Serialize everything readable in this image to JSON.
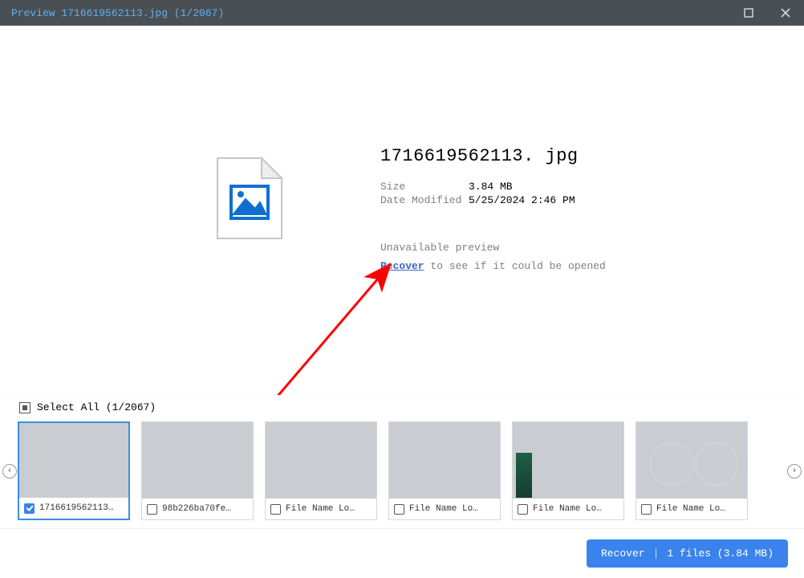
{
  "titlebar": {
    "text": "Preview 1716619562113.jpg (1/2067)"
  },
  "preview": {
    "filename": "1716619562113. jpg",
    "size_label": "Size",
    "size_value": "3.84 MB",
    "date_label": "Date Modified",
    "date_value": "5/25/2024 2:46 PM",
    "unavailable": "Unavailable preview",
    "recover_link": "Recover",
    "recover_tail": " to see if it could be opened"
  },
  "strip": {
    "select_all_label": "Select All (1/2067)",
    "items": [
      {
        "label": "1716619562113…",
        "checked": true,
        "pic": "fake-portrait",
        "selected": true
      },
      {
        "label": "98b226ba70fe…",
        "checked": false,
        "pic": "fake-car"
      },
      {
        "label": "File Name Lo…",
        "checked": false,
        "pic": "fake-game"
      },
      {
        "label": "File Name Lo…",
        "checked": false,
        "pic": "fake-woman"
      },
      {
        "label": "File Name Lo…",
        "checked": false,
        "pic": "fake-photo"
      },
      {
        "label": "File Name Lo…",
        "checked": false,
        "pic": "fake-fans"
      }
    ]
  },
  "footer": {
    "recover_label": "Recover",
    "summary": "1 files (3.84 MB)"
  }
}
